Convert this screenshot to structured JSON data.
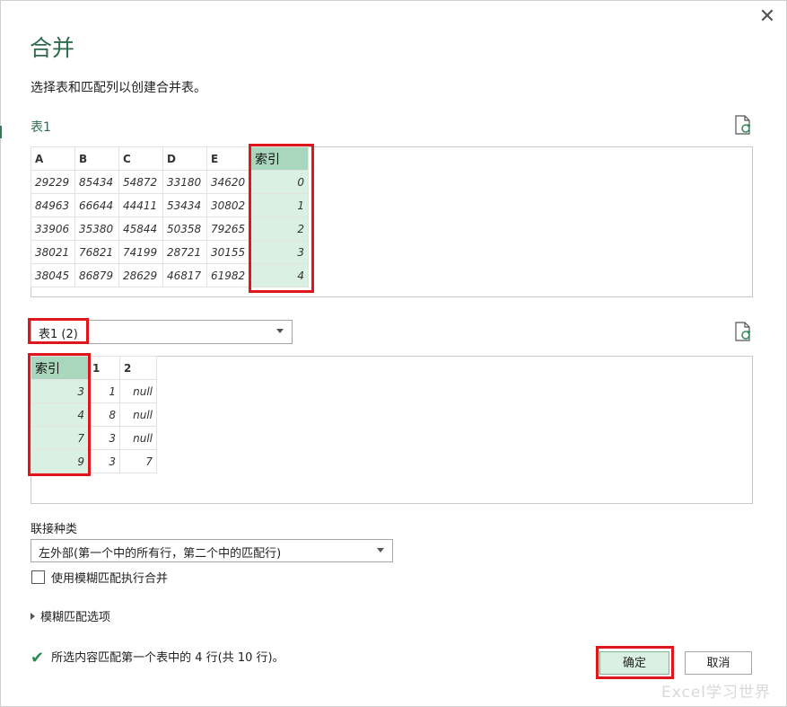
{
  "dialog": {
    "title": "合并",
    "subtitle": "选择表和匹配列以创建合并表。",
    "close_icon": "close-icon"
  },
  "table1": {
    "label": "表1",
    "headers": [
      "A",
      "B",
      "C",
      "D",
      "E",
      "索引"
    ],
    "rows": [
      [
        "29229",
        "85434",
        "54872",
        "33180",
        "34620",
        "0"
      ],
      [
        "84963",
        "66644",
        "44411",
        "53434",
        "30802",
        "1"
      ],
      [
        "33906",
        "35380",
        "45844",
        "50358",
        "79265",
        "2"
      ],
      [
        "38021",
        "76821",
        "74199",
        "28721",
        "30155",
        "3"
      ],
      [
        "38045",
        "86879",
        "28629",
        "46817",
        "61982",
        "4"
      ]
    ]
  },
  "table2": {
    "selector_value": "表1 (2)",
    "headers": [
      "索引",
      "1",
      "2"
    ],
    "rows": [
      [
        "3",
        "1",
        "null"
      ],
      [
        "4",
        "8",
        "null"
      ],
      [
        "7",
        "3",
        "null"
      ],
      [
        "9",
        "3",
        "7"
      ]
    ]
  },
  "join": {
    "label": "联接种类",
    "value": "左外部(第一个中的所有行，第二个中的匹配行)"
  },
  "fuzzy_checkbox": {
    "label": "使用模糊匹配执行合并",
    "checked": false
  },
  "fuzzy_options": {
    "label": "模糊匹配选项"
  },
  "status": {
    "text": "所选内容匹配第一个表中的 4 行(共 10 行)。"
  },
  "buttons": {
    "ok": "确定",
    "cancel": "取消"
  },
  "watermark": "Excel学习世界",
  "colors": {
    "accent": "#2e6b4f",
    "highlight_header": "#a9d7bd",
    "highlight_cell": "#d9f0e3",
    "red_box": "#e0161b"
  }
}
